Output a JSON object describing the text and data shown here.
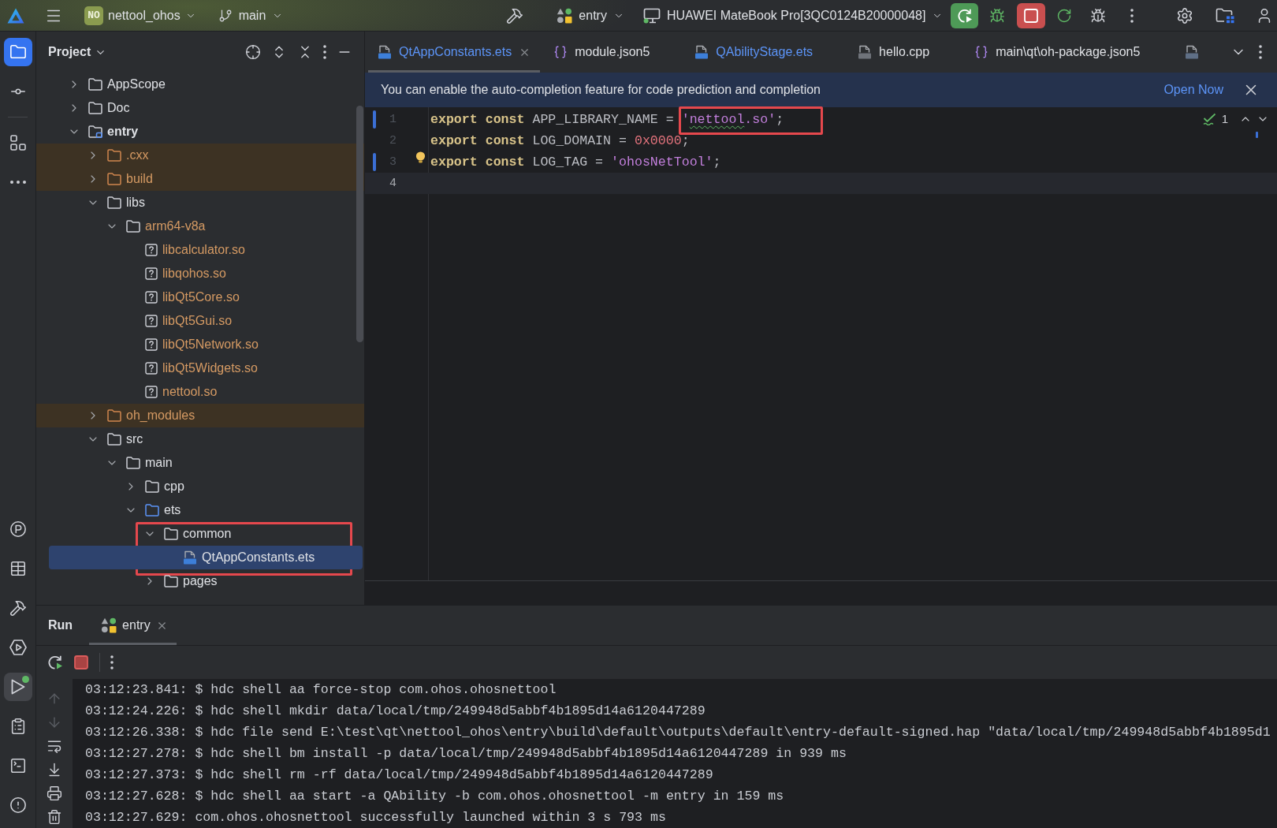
{
  "title_bar": {
    "project_badge": "NO",
    "project": "nettool_ohos",
    "branch": "main",
    "run_config": "entry",
    "device": "HUAWEI MateBook Pro[3QC0124B20000048]",
    "running": true
  },
  "tool_strip": {
    "top": [
      {
        "kind": "project",
        "selected": true
      },
      {
        "kind": "commit",
        "selected": false
      },
      {
        "kind": "structure",
        "selected": false
      },
      {
        "kind": "more",
        "selected": false
      }
    ],
    "bottom": [
      {
        "kind": "profiler",
        "selected": false,
        "running": false
      },
      {
        "kind": "layout",
        "selected": false,
        "running": false
      },
      {
        "kind": "build",
        "selected": false,
        "running": false
      },
      {
        "kind": "services",
        "selected": false,
        "running": false
      },
      {
        "kind": "run",
        "selected": true,
        "running": true
      },
      {
        "kind": "todo",
        "selected": false,
        "running": false
      },
      {
        "kind": "terminal",
        "selected": false,
        "running": false
      },
      {
        "kind": "problems",
        "selected": false,
        "running": false
      }
    ]
  },
  "project_panel": {
    "title": "Project",
    "tree": [
      {
        "label": "AppScope",
        "kind": "folder",
        "expanded": false,
        "selected": false,
        "excluded": false,
        "ignored": false,
        "marked": false
      },
      {
        "label": "Doc",
        "kind": "folder",
        "expanded": false,
        "selected": false,
        "excluded": false,
        "ignored": false,
        "marked": false
      },
      {
        "label": "entry",
        "kind": "module",
        "expanded": true,
        "selected": false,
        "excluded": false,
        "ignored": false,
        "marked": false,
        "children": [
          {
            "label": ".cxx",
            "kind": "folder",
            "expanded": false,
            "selected": false,
            "excluded": true,
            "ignored": true,
            "marked": false
          },
          {
            "label": "build",
            "kind": "folder",
            "expanded": false,
            "selected": false,
            "excluded": true,
            "ignored": true,
            "marked": false
          },
          {
            "label": "libs",
            "kind": "folder",
            "expanded": true,
            "selected": false,
            "excluded": false,
            "ignored": false,
            "marked": false,
            "children": [
              {
                "label": "arm64-v8a",
                "kind": "folder",
                "expanded": true,
                "selected": false,
                "excluded": false,
                "ignored": true,
                "marked": false,
                "children": [
                  {
                    "label": "libcalculator.so",
                    "kind": "unknown_file",
                    "selected": false,
                    "excluded": false,
                    "ignored": true,
                    "marked": false
                  },
                  {
                    "label": "libqohos.so",
                    "kind": "unknown_file",
                    "selected": false,
                    "excluded": false,
                    "ignored": true,
                    "marked": false
                  },
                  {
                    "label": "libQt5Core.so",
                    "kind": "unknown_file",
                    "selected": false,
                    "excluded": false,
                    "ignored": true,
                    "marked": false
                  },
                  {
                    "label": "libQt5Gui.so",
                    "kind": "unknown_file",
                    "selected": false,
                    "excluded": false,
                    "ignored": true,
                    "marked": false
                  },
                  {
                    "label": "libQt5Network.so",
                    "kind": "unknown_file",
                    "selected": false,
                    "excluded": false,
                    "ignored": true,
                    "marked": false
                  },
                  {
                    "label": "libQt5Widgets.so",
                    "kind": "unknown_file",
                    "selected": false,
                    "excluded": false,
                    "ignored": true,
                    "marked": false
                  },
                  {
                    "label": "nettool.so",
                    "kind": "unknown_file",
                    "selected": false,
                    "excluded": false,
                    "ignored": true,
                    "marked": false
                  }
                ]
              }
            ]
          },
          {
            "label": "oh_modules",
            "kind": "folder",
            "expanded": false,
            "selected": false,
            "excluded": true,
            "ignored": true,
            "marked": false
          },
          {
            "label": "src",
            "kind": "folder",
            "expanded": true,
            "selected": false,
            "excluded": false,
            "ignored": false,
            "marked": false,
            "children": [
              {
                "label": "main",
                "kind": "folder",
                "expanded": true,
                "selected": false,
                "excluded": false,
                "ignored": false,
                "marked": false,
                "children": [
                  {
                    "label": "cpp",
                    "kind": "folder",
                    "expanded": false,
                    "selected": false,
                    "excluded": false,
                    "ignored": false,
                    "marked": false
                  },
                  {
                    "label": "ets",
                    "kind": "source_folder",
                    "expanded": true,
                    "selected": false,
                    "excluded": false,
                    "ignored": false,
                    "marked": false,
                    "children": [
                      {
                        "label": "common",
                        "kind": "folder",
                        "expanded": true,
                        "selected": false,
                        "excluded": false,
                        "ignored": false,
                        "marked": true,
                        "children": [
                          {
                            "label": "QtAppConstants.ets",
                            "kind": "ets_file",
                            "selected": true,
                            "excluded": false,
                            "ignored": false,
                            "marked": false
                          }
                        ]
                      },
                      {
                        "label": "pages",
                        "kind": "folder",
                        "expanded": false,
                        "selected": false,
                        "excluded": false,
                        "ignored": false,
                        "marked": false
                      }
                    ]
                  }
                ]
              }
            ]
          }
        ]
      }
    ]
  },
  "editor": {
    "tabs": [
      {
        "label": "QtAppConstants.ets",
        "kind": "ets",
        "selected": true,
        "modified": true
      },
      {
        "label": "module.json5",
        "kind": "json",
        "selected": false,
        "modified": false
      },
      {
        "label": "QAbilityStage.ets",
        "kind": "ets",
        "selected": false,
        "modified": true
      },
      {
        "label": "hello.cpp",
        "kind": "cpp",
        "selected": false,
        "modified": false
      },
      {
        "label": "main\\qt\\oh-package.json5",
        "kind": "json",
        "selected": false,
        "modified": false
      },
      {
        "kind": "ts",
        "selected": false
      }
    ],
    "notice": {
      "text": "You can enable the auto-completion feature for code prediction and completion",
      "action": "Open Now"
    },
    "inspections": "1",
    "lines": [
      {
        "number": "1",
        "changed": true,
        "current": false,
        "bulb": false,
        "tokens": [
          {
            "kind": "keyword",
            "text": "export const",
            "typo": false
          },
          {
            "kind": "plain",
            "text": " APP_LIBRARY_NAME = ",
            "typo": false
          },
          {
            "kind": "group",
            "boxed": true,
            "tokens": [
              {
                "kind": "string",
                "text": "'",
                "typo": false
              },
              {
                "kind": "string",
                "text": "nettool",
                "typo": true
              },
              {
                "kind": "string",
                "text": ".so'",
                "typo": false
              },
              {
                "kind": "plain",
                "text": ";",
                "typo": false
              }
            ]
          }
        ]
      },
      {
        "number": "2",
        "changed": false,
        "current": false,
        "bulb": false,
        "tokens": [
          {
            "kind": "keyword",
            "text": "export const",
            "typo": false
          },
          {
            "kind": "plain",
            "text": " LOG_DOMAIN = ",
            "typo": false
          },
          {
            "kind": "number",
            "text": "0x0000",
            "typo": false
          },
          {
            "kind": "plain",
            "text": ";",
            "typo": false
          }
        ]
      },
      {
        "number": "3",
        "changed": true,
        "current": false,
        "bulb": true,
        "tokens": [
          {
            "kind": "keyword",
            "text": "export const",
            "typo": false
          },
          {
            "kind": "plain",
            "text": " LOG_TAG = ",
            "typo": false
          },
          {
            "kind": "string",
            "text": "'ohosNetTool'",
            "typo": false
          },
          {
            "kind": "plain",
            "text": ";",
            "typo": false
          }
        ]
      },
      {
        "number": "4",
        "changed": false,
        "current": true,
        "bulb": false
      }
    ]
  },
  "run_panel": {
    "title": "Run",
    "running": true,
    "tabs": [
      {
        "label": "entry",
        "selected": true
      }
    ],
    "console": [
      "03:12:23.841: $ hdc shell aa force-stop com.ohos.ohosnettool",
      "03:12:24.226: $ hdc shell mkdir data/local/tmp/249948d5abbf4b1895d14a6120447289",
      "03:12:26.338: $ hdc file send E:\\test\\qt\\nettool_ohos\\entry\\build\\default\\outputs\\default\\entry-default-signed.hap \"data/local/tmp/249948d5abbf4b1895d1",
      "03:12:27.278: $ hdc shell bm install -p data/local/tmp/249948d5abbf4b1895d14a6120447289 in 939 ms",
      "03:12:27.373: $ hdc shell rm -rf data/local/tmp/249948d5abbf4b1895d14a6120447289",
      "03:12:27.628: $ hdc shell aa start -a QAbility -b com.ohos.ohosnettool -m entry in 159 ms",
      "03:12:27.629: com.ohos.ohosnettool successfully launched within 3 s 793 ms"
    ]
  }
}
